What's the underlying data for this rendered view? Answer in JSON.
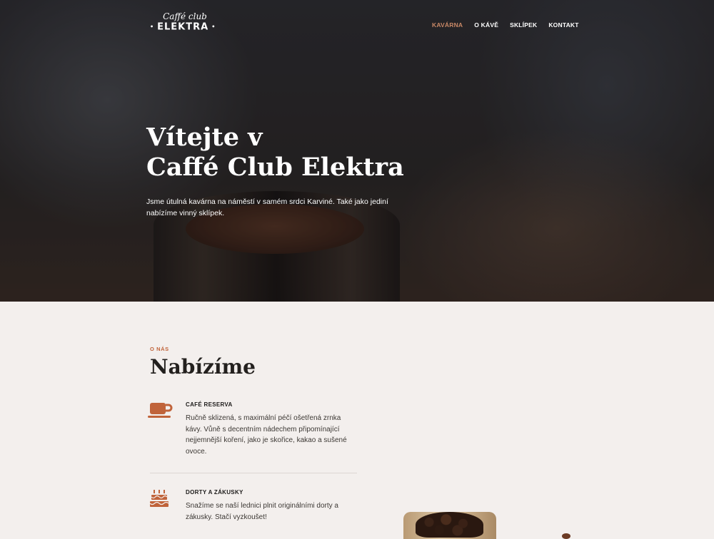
{
  "logo": {
    "script": "Caffé club",
    "main": "ELEKTRA",
    "dot": "•"
  },
  "nav": {
    "items": [
      {
        "label": "KAVÁRNA",
        "active": true
      },
      {
        "label": "O KÁVĚ",
        "active": false
      },
      {
        "label": "SKLÍPEK",
        "active": false
      },
      {
        "label": "KONTAKT",
        "active": false
      }
    ]
  },
  "hero": {
    "title_line1": "Vítejte v",
    "title_line2": "Caffé Club Elektra",
    "text": "Jsme útulná kavárna na náměstí v samém srdci Karviné. Také jako jediní nabízíme vinný sklípek."
  },
  "about": {
    "kicker": "O NÁS",
    "title": "Nabízíme",
    "features": [
      {
        "icon": "coffee-cup-icon",
        "title": "CAFÉ RESERVA",
        "text": "Ručně sklizená, s maximální péčí ošetřená zrnka kávy. Vůně s decentním nádechem připomínající nejjemnější koření, jako je skořice, kakao a sušené ovoce."
      },
      {
        "icon": "birthday-cake-icon",
        "title": "DORTY A ZÁKUSKY",
        "text": "Snažíme se naší lednici plnit originálními dorty a zákusky. Stačí vyzkoušet!"
      }
    ]
  },
  "colors": {
    "accent": "#c98866",
    "icon": "#c0633a",
    "background": "#f3efed"
  }
}
